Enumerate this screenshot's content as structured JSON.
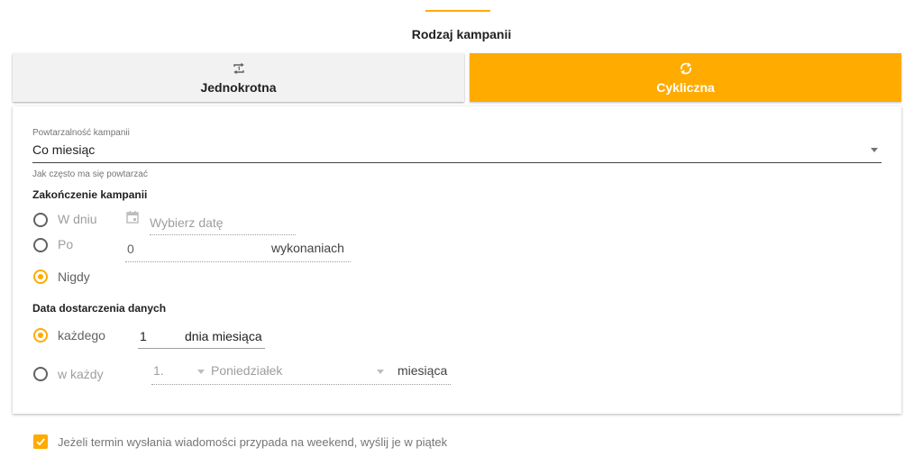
{
  "section_title": "Rodzaj kampanii",
  "tabs": {
    "one_time": "Jednokrotna",
    "cyclic": "Cykliczna"
  },
  "frequency": {
    "label": "Powtarzalność kampanii",
    "value": "Co miesiąc",
    "hint": "Jak często ma się powtarzać"
  },
  "end": {
    "title": "Zakończenie kampanii",
    "on_date_label": "W dniu",
    "date_placeholder": "Wybierz datę",
    "after_label": "Po",
    "after_value": "0",
    "after_suffix": "wykonaniach",
    "never_label": "Nigdy",
    "selected": "Nigdy"
  },
  "delivery": {
    "title": "Data dostarczenia danych",
    "each_label": "każdego",
    "each_value": "1",
    "each_suffix": "dnia miesiąca",
    "every_label": "w każdy",
    "ordinal": "1.",
    "weekday": "Poniedziałek",
    "every_suffix": "miesiąca",
    "selected": "każdego"
  },
  "weekend_checkbox": {
    "label": "Jeżeli termin wysłania wiadomości przypada na weekend, wyślij je w piątek",
    "checked": true
  },
  "colors": {
    "accent": "#ffab00",
    "inactive_tab": "#f2f2f2"
  },
  "icons": {
    "one_time": "repeat-one-icon",
    "cyclic": "sync-icon",
    "date": "calendar-icon",
    "dropdown": "caret-down-icon",
    "check": "check-icon"
  }
}
